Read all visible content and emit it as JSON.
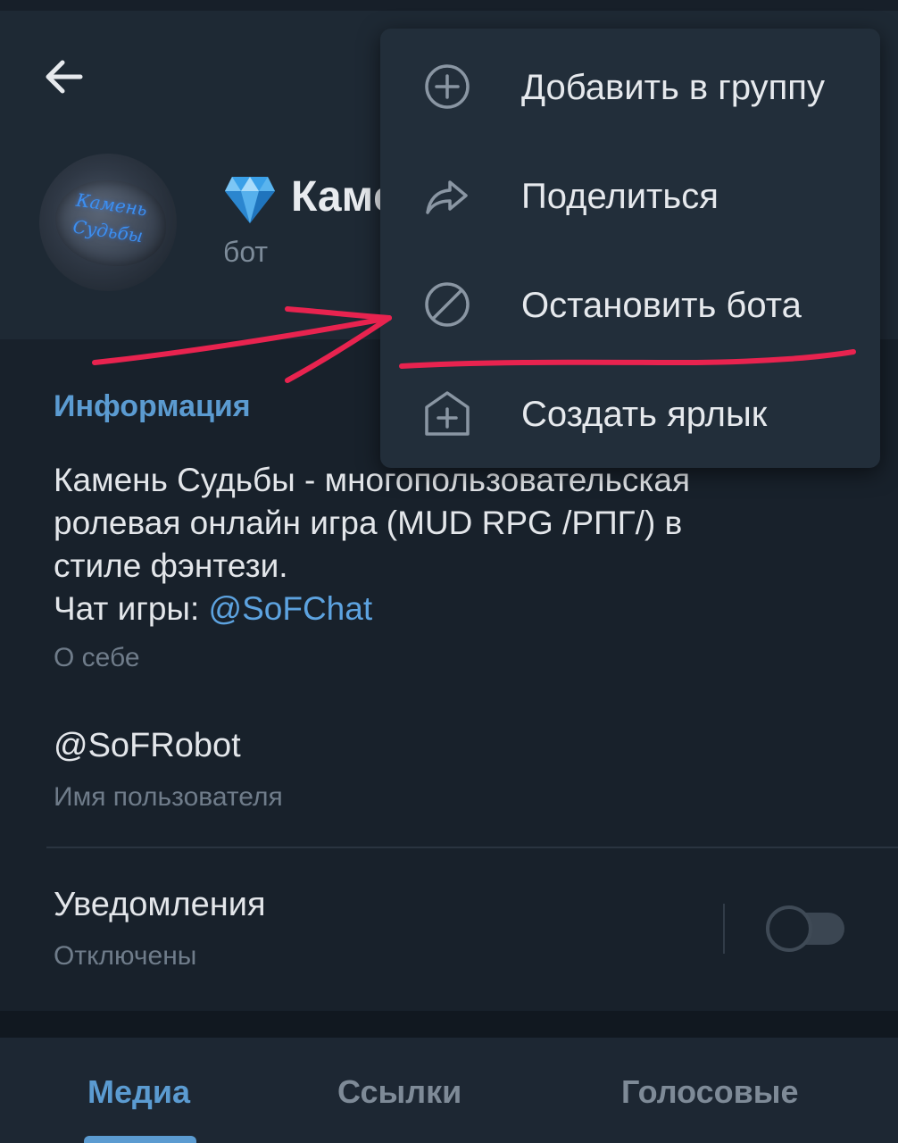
{
  "header": {
    "title": "Камень Судьбы",
    "subtitle": "бот",
    "avatar_text": "Камень Судьбы"
  },
  "menu": {
    "items": [
      {
        "label": "Добавить в группу",
        "icon": "add-circle-icon"
      },
      {
        "label": "Поделиться",
        "icon": "share-icon"
      },
      {
        "label": "Остановить бота",
        "icon": "block-icon"
      },
      {
        "label": "Создать ярлык",
        "icon": "add-shortcut-icon"
      }
    ]
  },
  "info": {
    "section_title": "Информация",
    "about_lines": [
      "Камень Судьбы - многопользовательская",
      "ролевая онлайн игра (MUD RPG /РПГ/) в",
      "стиле фэнтези."
    ],
    "chat_prefix": "Чат игры: ",
    "chat_link": "@SoFChat",
    "about_hint": "О себе",
    "username": "@SoFRobot",
    "username_hint": "Имя пользователя",
    "notifications_label": "Уведомления",
    "notifications_status": "Отключены",
    "notifications_enabled": false
  },
  "tabs": {
    "items": [
      {
        "label": "Медиа",
        "active": true
      },
      {
        "label": "Ссылки",
        "active": false
      },
      {
        "label": "Голосовые",
        "active": false
      }
    ]
  },
  "colors": {
    "accent": "#5b9bd1",
    "annotation": "#e8234f",
    "background": "#18212b"
  }
}
